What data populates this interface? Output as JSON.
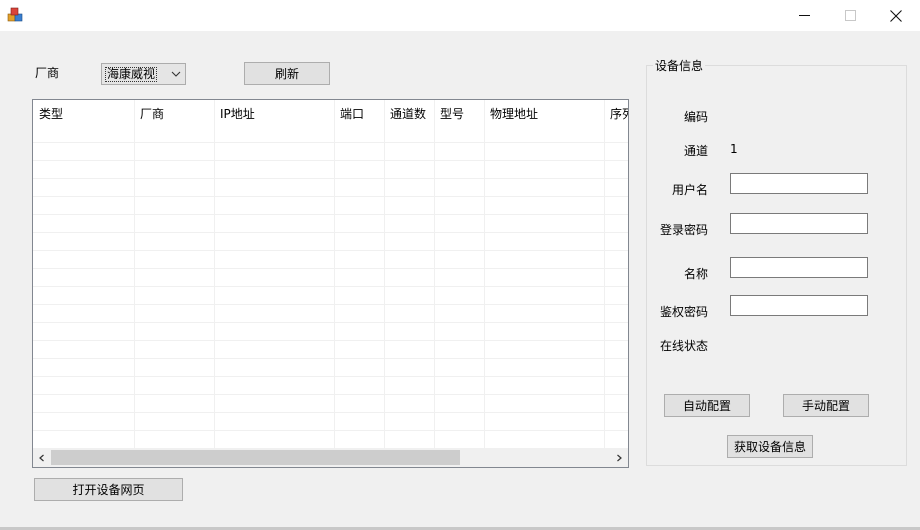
{
  "window": {
    "title": "",
    "icons": {
      "app": "app-cubes-icon",
      "minimize": "minimize-icon",
      "maximize": "maximize-icon",
      "close": "close-icon"
    }
  },
  "toolbar": {
    "vendor_label": "厂商",
    "vendor_value": "海康威视",
    "refresh_label": "刷新"
  },
  "table": {
    "columns": [
      "类型",
      "厂商",
      "IP地址",
      "端口",
      "通道数",
      "型号",
      "物理地址",
      "序列号"
    ],
    "rows": []
  },
  "device_info": {
    "group_title": "设备信息",
    "code_label": "编码",
    "code_value": "",
    "channel_label": "通道",
    "channel_value": "1",
    "username_label": "用户名",
    "username_value": "",
    "password_label": "登录密码",
    "password_value": "",
    "name_label": "名称",
    "name_value": "",
    "auth_password_label": "鉴权密码",
    "auth_password_value": "",
    "online_status_label": "在线状态",
    "online_status_value": "",
    "auto_config_label": "自动配置",
    "manual_config_label": "手动配置",
    "get_info_label": "获取设备信息"
  },
  "open_web_label": "打开设备网页"
}
